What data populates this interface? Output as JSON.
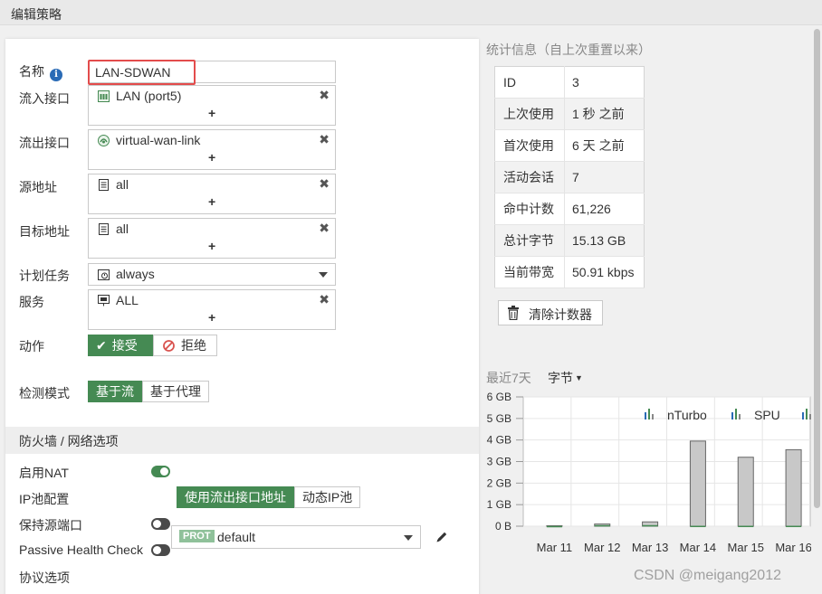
{
  "window": {
    "title": "编辑策略"
  },
  "form": {
    "name": {
      "label": "名称",
      "value": "LAN-SDWAN"
    },
    "incoming": {
      "label": "流入接口",
      "value": "LAN (port5)"
    },
    "outgoing": {
      "label": "流出接口",
      "value": "virtual-wan-link"
    },
    "source": {
      "label": "源地址",
      "value": "all"
    },
    "destination": {
      "label": "目标地址",
      "value": "all"
    },
    "schedule": {
      "label": "计划任务",
      "value": "always"
    },
    "service": {
      "label": "服务",
      "value": "ALL"
    },
    "action": {
      "label": "动作",
      "accept": "接受",
      "deny": "拒绝"
    },
    "inspection": {
      "label": "检测模式",
      "flow": "基于流",
      "proxy": "基于代理"
    },
    "plus": "+",
    "remove": "✖"
  },
  "firewall": {
    "section_title": "防火墙 / 网络选项",
    "nat": {
      "label": "启用NAT",
      "enabled": true
    },
    "ippool": {
      "label": "IP池配置",
      "option_outgoing": "使用流出接口地址",
      "option_dynamic": "动态IP池"
    },
    "preserve_port": {
      "label": "保持源端口",
      "enabled": false
    },
    "health_check": {
      "label": "Passive Health Check",
      "enabled": false
    },
    "protocol": {
      "label": "协议选项",
      "badge": "PROT",
      "value": "default"
    }
  },
  "stats": {
    "title": "统计信息（自上次重置以来）",
    "rows": [
      {
        "key": "ID",
        "value": "3"
      },
      {
        "key": "上次使用",
        "value": "1 秒 之前"
      },
      {
        "key": "首次使用",
        "value": "6 天 之前"
      },
      {
        "key": "活动会话",
        "value": "7"
      },
      {
        "key": "命中计数",
        "value": "61,226"
      },
      {
        "key": "总计字节",
        "value": "15.13 GB"
      },
      {
        "key": "当前带宽",
        "value": "50.91 kbps"
      }
    ],
    "clear_label": "清除计数器"
  },
  "chart_header": {
    "period": "最近7天",
    "metric": "字节"
  },
  "colors": {
    "accent": "#458a53",
    "highlight": "#e34c4c"
  },
  "chart_data": {
    "type": "bar",
    "categories": [
      "Mar 11",
      "Mar 12",
      "Mar 13",
      "Mar 14",
      "Mar 15",
      "Mar 16"
    ],
    "y_tick_labels": [
      "0 B",
      "1 GB",
      "2 GB",
      "3 GB",
      "4 GB",
      "5 GB",
      "6 GB"
    ],
    "ylim": [
      0,
      6
    ],
    "series": [
      {
        "name": "nTurbo",
        "values": [
          0.02,
          0.03,
          0.03,
          0.01,
          0.01,
          0.01
        ]
      },
      {
        "name": "SPU",
        "values": [
          0.01,
          0.05,
          0.05,
          0.02,
          0.02,
          0.02
        ]
      },
      {
        "name": "",
        "values": [
          0.02,
          0.1,
          0.2,
          3.95,
          3.2,
          3.55
        ]
      }
    ],
    "grid": true,
    "legend": "top-right"
  },
  "watermark": "CSDN @meigang2012"
}
